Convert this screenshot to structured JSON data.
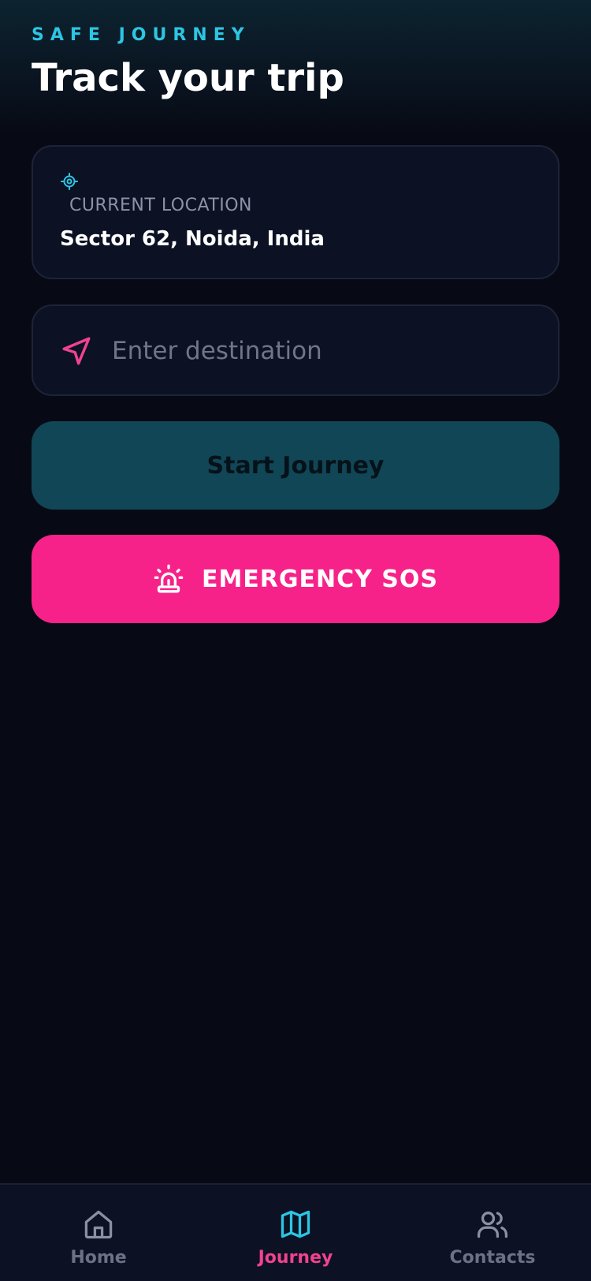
{
  "header": {
    "eyebrow": "SAFE JOURNEY",
    "title": "Track your trip"
  },
  "current_location": {
    "icon": "crosshair-icon",
    "label": "CURRENT LOCATION",
    "value": "Sector 62, Noida, India"
  },
  "destination": {
    "icon": "navigation-arrow-icon",
    "value": "",
    "placeholder": "Enter destination"
  },
  "actions": {
    "start_label": "Start Journey",
    "sos_label": "EMERGENCY SOS",
    "sos_icon": "siren-icon"
  },
  "tabs": [
    {
      "label": "Home",
      "icon": "home-icon",
      "active": false
    },
    {
      "label": "Journey",
      "icon": "map-icon",
      "active": true
    },
    {
      "label": "Contacts",
      "icon": "users-icon",
      "active": false
    }
  ],
  "colors": {
    "accent_cyan": "#2cc6e3",
    "accent_pink": "#f72289",
    "background": "#070a15",
    "card": "#0c1124",
    "start_button": "#114656"
  }
}
